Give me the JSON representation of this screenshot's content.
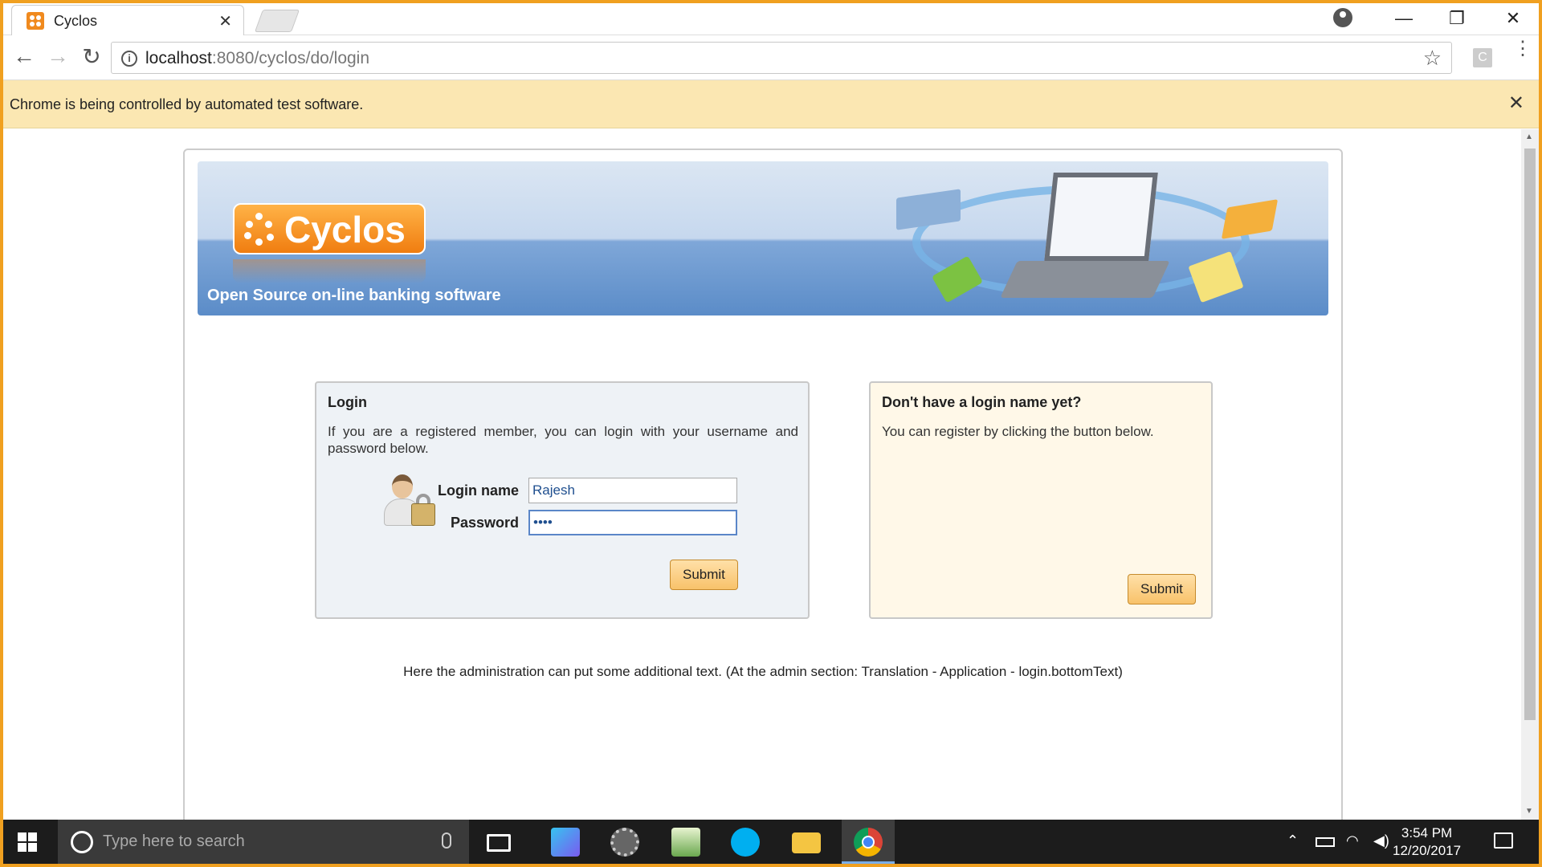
{
  "browser": {
    "tab_title": "Cyclos",
    "tab_close": "✕",
    "url_host": "localhost",
    "url_path": ":8080/cyclos/do/login",
    "ext_letter": "C",
    "infobar_text": "Chrome is being controlled by automated test software.",
    "infobar_close": "✕",
    "win_minimize": "—",
    "win_restore": "❐",
    "win_close": "✕",
    "back": "←",
    "forward": "→",
    "reload": "↻",
    "star": "☆",
    "menu": "⋮"
  },
  "banner": {
    "logo_text": "Cyclos",
    "tagline": "Open Source on-line banking software"
  },
  "login": {
    "title": "Login",
    "description": "If you are a registered member, you can login with your username and password below.",
    "login_name_label": "Login name",
    "login_name_value": "Rajesh",
    "password_label": "Password",
    "password_value": "••••",
    "submit_label": "Submit"
  },
  "register": {
    "title": "Don't have a login name yet?",
    "description": "You can register by clicking the button below.",
    "submit_label": "Submit"
  },
  "bottom_text": "Here the administration can put some additional text. (At the admin section: Translation - Application - login.bottomText)",
  "taskbar": {
    "search_placeholder": "Type here to search",
    "time": "3:54 PM",
    "date": "12/20/2017"
  },
  "colors": {
    "accent_orange": "#f07d10",
    "infobar_bg": "#fbe7b2",
    "login_panel_bg": "#eef2f6",
    "register_panel_bg": "#fff8e8"
  }
}
